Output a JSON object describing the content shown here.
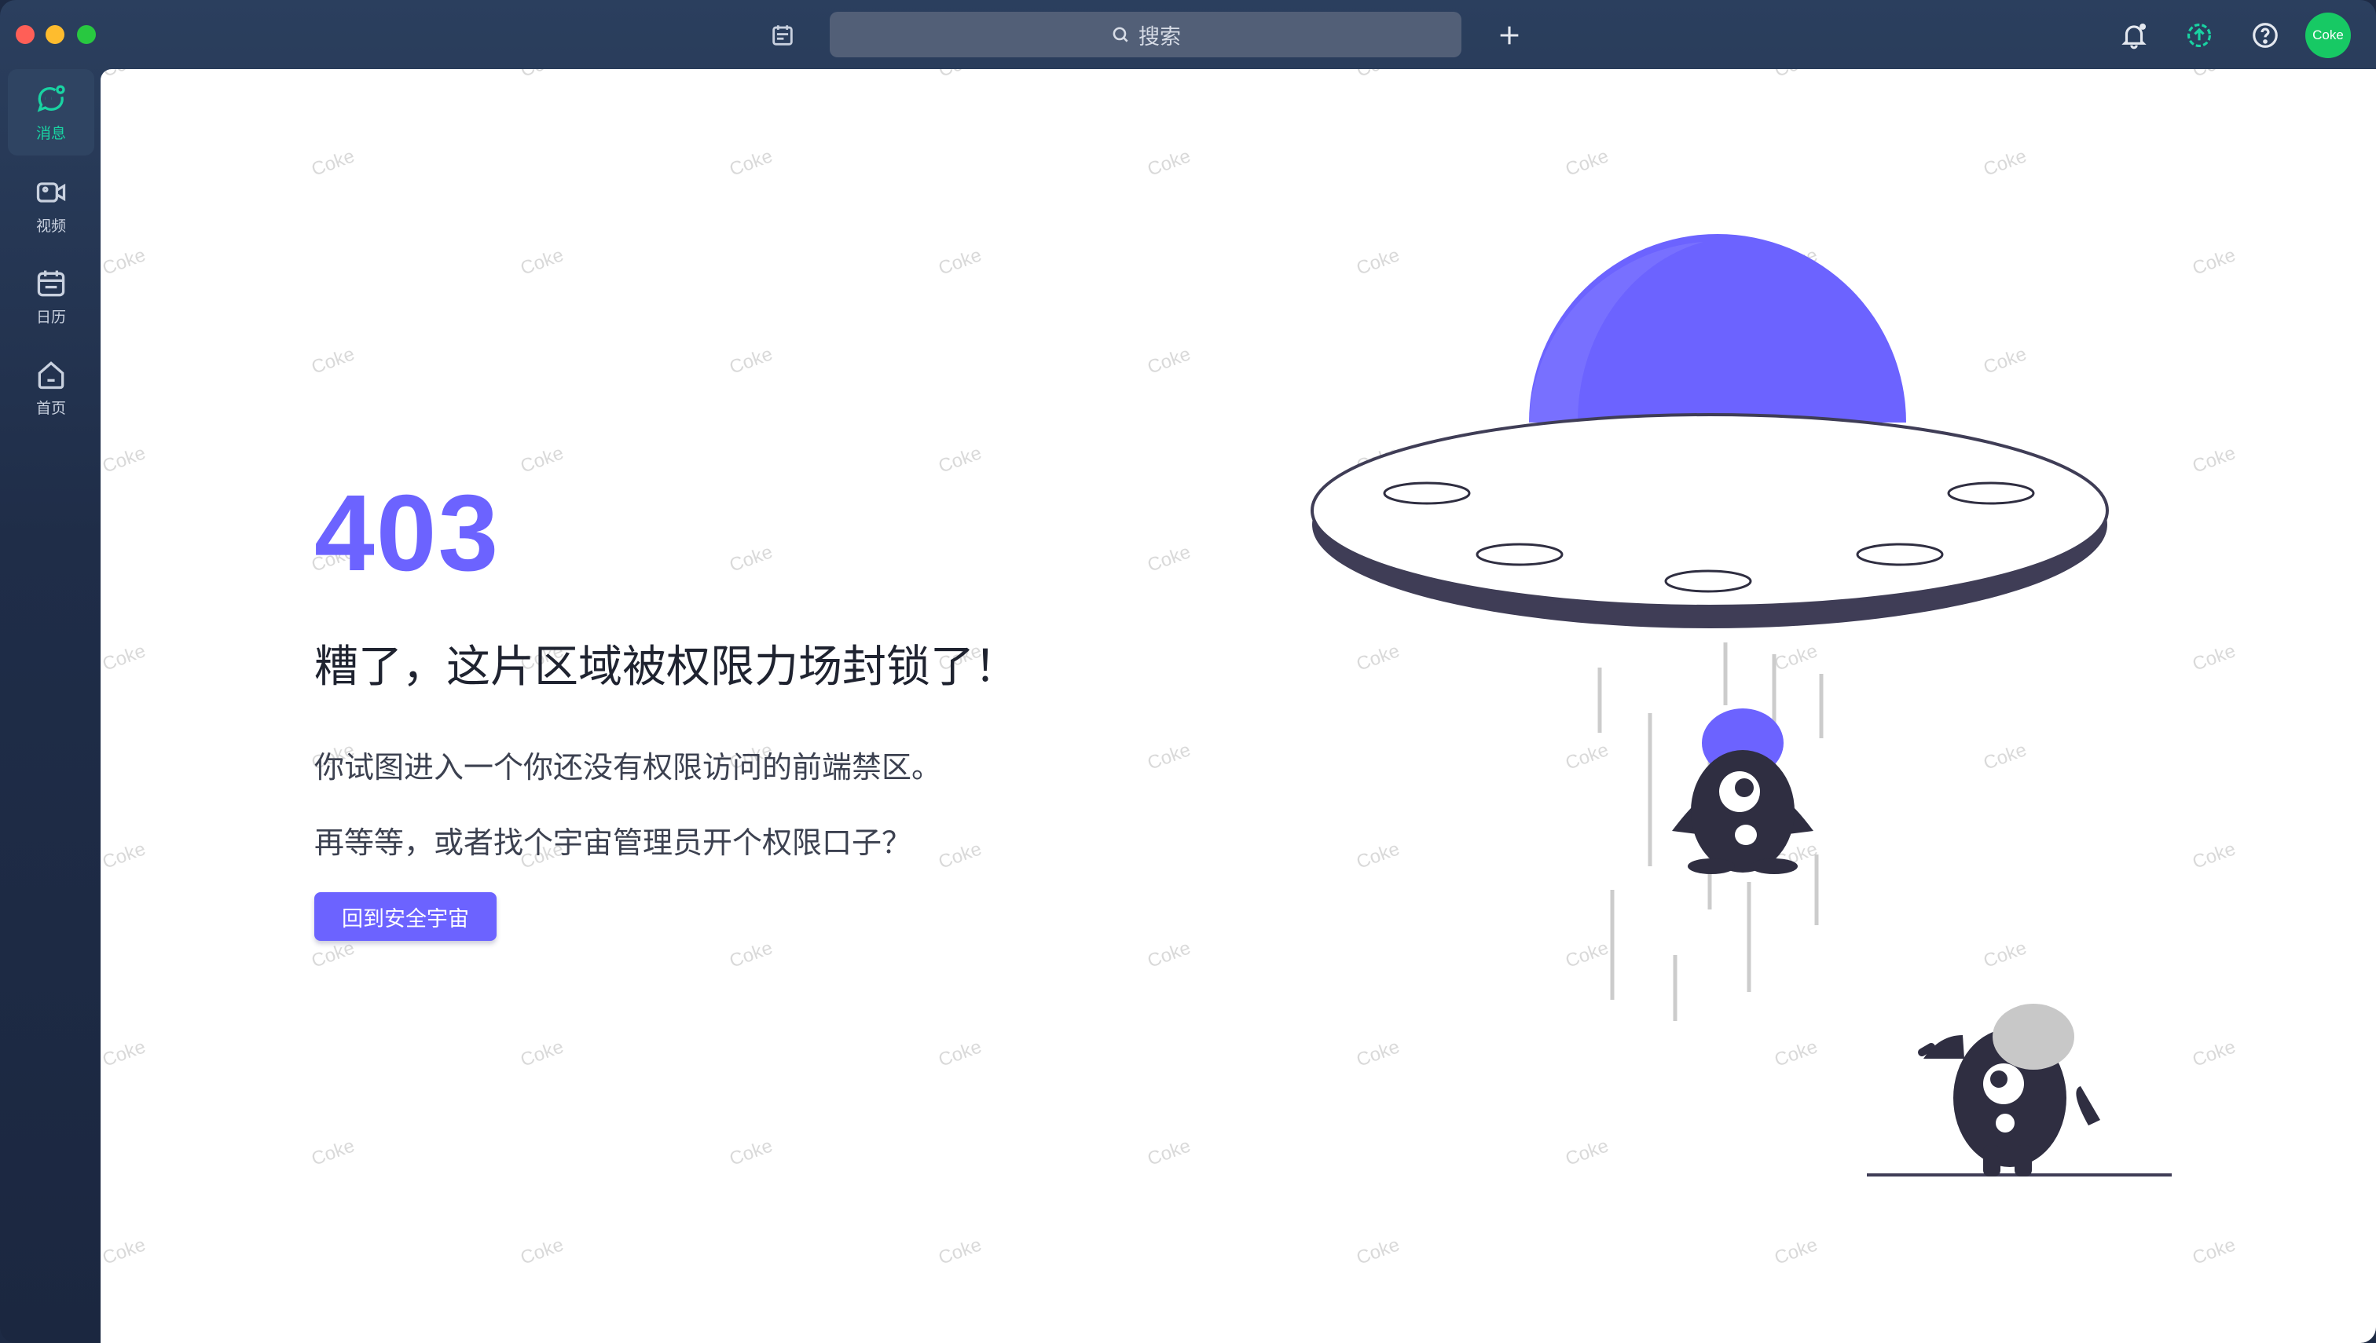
{
  "titlebar": {
    "search_placeholder": "搜索",
    "avatar_text": "Coke"
  },
  "sidebar": {
    "items": [
      {
        "label": "消息",
        "icon": "chat-icon",
        "active": true
      },
      {
        "label": "视频",
        "icon": "video-icon"
      },
      {
        "label": "日历",
        "icon": "calendar-icon"
      },
      {
        "label": "首页",
        "icon": "home-icon"
      }
    ]
  },
  "error": {
    "code": "403",
    "headline": "糟了，这片区域被权限力场封锁了！",
    "line1": "你试图进入一个你还没有权限访问的前端禁区。",
    "line2": "再等等，或者找个宇宙管理员开个权限口子？",
    "button_label": "回到安全宇宙"
  },
  "watermark": "Coke",
  "colors": {
    "accent": "#6c63ff",
    "active_nav": "#19d3a2",
    "avatar": "#17c964",
    "dark_figure": "#2f2e41"
  }
}
